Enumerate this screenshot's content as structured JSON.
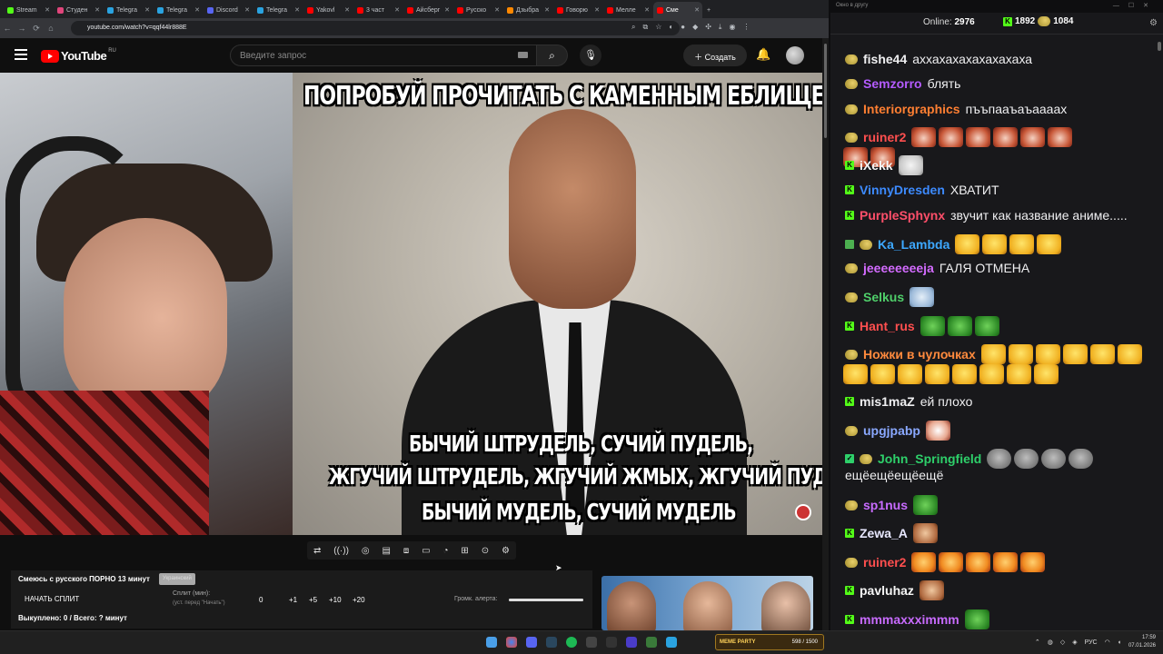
{
  "browser": {
    "tabs": [
      {
        "label": "Stream",
        "color": "#53fc18"
      },
      {
        "label": "Студен",
        "color": "#e0457b"
      },
      {
        "label": "Telegra",
        "color": "#2aa3e0"
      },
      {
        "label": "Telegra",
        "color": "#2aa3e0"
      },
      {
        "label": "Discord",
        "color": "#5865f2"
      },
      {
        "label": "Telegra",
        "color": "#2aa3e0"
      },
      {
        "label": "Yakovl",
        "color": "#ff0000"
      },
      {
        "label": "3 част",
        "color": "#ff0000"
      },
      {
        "label": "Айсберг",
        "color": "#ff0000"
      },
      {
        "label": "Русско",
        "color": "#ff0000"
      },
      {
        "label": "Дзыбра",
        "color": "#ff8800"
      },
      {
        "label": "Говорю",
        "color": "#ff0000"
      },
      {
        "label": "Мелле",
        "color": "#ff0000"
      },
      {
        "label": "Сме",
        "color": "#ff0000",
        "active": true
      }
    ],
    "new_tab": "+",
    "url": "youtube.com/watch?v=qqf44lr888E",
    "window_controls": [
      "⌄",
      "—",
      "☐",
      "✕"
    ]
  },
  "youtube": {
    "logo_text": "YouTube",
    "country": "RU",
    "search_placeholder": "Введите запрос",
    "create_label": "Создать"
  },
  "video": {
    "meme_top": "ПОПРОБУЙ ПРОЧИТАТЬ С КАМЕННЫМ ЕБЛИЩЕМ",
    "meme_line1": "БЫЧИЙ ШТРУДЕЛЬ, СУЧИЙ ПУДЕЛЬ,",
    "meme_line2": "ЖГУЧИЙ ШТРУДЕЛЬ, ЖГУЧИЙ ЖМЫХ, ЖГУЧИЙ ПУДЕЛЬ",
    "meme_line3": "БЫЧИЙ МУДЕЛЬ, СУЧИЙ МУДЕЛЬ"
  },
  "panel": {
    "title": "Смеюсь с русского ПОРНО 13 минут",
    "tag": "Украинский",
    "start_button": "НАЧАТЬ СПЛИТ",
    "split_label": "Сплит (мин):",
    "split_sub": "(уст. перед \"Начать\")",
    "split_value": "0",
    "increments": [
      "+1",
      "+5",
      "+10",
      "+20"
    ],
    "alert_label": "Громк. алерта:",
    "alert_volume": 1.0,
    "bought": "Выкуплено: 0 / Всего: ? минут"
  },
  "chat": {
    "window_title": "Окно в другу",
    "online_label": "Online:",
    "online_count": "2976",
    "kick_count": "1892",
    "twitch_count": "1084",
    "messages": [
      {
        "platform": "twitch",
        "user": "fishe44",
        "color": "#efeff1",
        "text": "аххахахахахахахаха",
        "emotes": []
      },
      {
        "platform": "twitch",
        "user": "Semzorro",
        "color": "#b45bff",
        "text": "блять",
        "emotes": []
      },
      {
        "platform": "twitch",
        "user": "Interiorgraphics",
        "color": "#ff7f32",
        "text": "пъъпааъаъааааx",
        "emotes": []
      },
      {
        "platform": "twitch",
        "user": "ruiner2",
        "color": "#ff4f4f",
        "text": "",
        "emotes": [
          "red",
          "red",
          "red",
          "red",
          "red",
          "red",
          "red",
          "red"
        ]
      },
      {
        "platform": "kick",
        "user": "iXekk",
        "color": "#f5f5f5",
        "text": "",
        "emotes": [
          "cat"
        ]
      },
      {
        "platform": "kick",
        "user": "VinnyDresden",
        "color": "#3d8bff",
        "text": "ХВАТИТ",
        "emotes": []
      },
      {
        "platform": "kick",
        "user": "PurpleSphynx",
        "color": "#ff4f6a",
        "text": "звучит как название аниме.....",
        "emotes": []
      },
      {
        "platform": "twitch-sub",
        "user": "Ka_Lambda",
        "color": "#3da8ff",
        "text": "",
        "emotes": [
          "laugh",
          "laugh",
          "laugh",
          "laugh"
        ]
      },
      {
        "platform": "twitch",
        "user": "jeeeeeeeeja",
        "color": "#d36bff",
        "text": "ГАЛЯ ОТМЕНА",
        "emotes": []
      },
      {
        "platform": "twitch",
        "user": "Selkus",
        "color": "#4fcf6a",
        "text": "",
        "emotes": [
          "blue"
        ]
      },
      {
        "platform": "kick",
        "user": "Hant_rus",
        "color": "#ff4f4f",
        "text": "",
        "emotes": [
          "pepe",
          "pepe",
          "pepe"
        ]
      },
      {
        "platform": "twitch",
        "user": "Ножки в чулочках",
        "color": "#ff8a3d",
        "text": "",
        "emotes": [
          "laugh",
          "laugh",
          "laugh",
          "laugh",
          "laugh",
          "laugh",
          "laugh",
          "laugh",
          "laugh",
          "laugh",
          "laugh",
          "laugh",
          "laugh",
          "laugh"
        ]
      },
      {
        "platform": "kick",
        "user": "mis1maZ",
        "color": "#efeff1",
        "text": "ей плохо",
        "emotes": []
      },
      {
        "platform": "twitch",
        "user": "upgjpabp",
        "color": "#8aa8ff",
        "text": "",
        "emotes": [
          "fist"
        ]
      },
      {
        "platform": "twitch-edit",
        "user": "John_Springfield",
        "color": "#2ecf6a",
        "text": "ещёещёещёещё",
        "emotes": [
          "gray",
          "gray",
          "gray",
          "gray"
        ]
      },
      {
        "platform": "twitch",
        "user": "sp1nus",
        "color": "#c86bff",
        "text": "",
        "emotes": [
          "pepe"
        ]
      },
      {
        "platform": "kick",
        "user": "Zewa_A",
        "color": "#e8e8ff",
        "text": "",
        "emotes": [
          "doge"
        ]
      },
      {
        "platform": "twitch",
        "user": "ruiner2",
        "color": "#ff4f4f",
        "text": "",
        "emotes": [
          "tiger",
          "tiger",
          "tiger",
          "tiger",
          "tiger"
        ]
      },
      {
        "platform": "kick",
        "user": "pavluhaz",
        "color": "#f5f5f5",
        "text": "",
        "emotes": [
          "doge"
        ]
      },
      {
        "platform": "kick",
        "user": "mmmaxxximmm",
        "color": "#c86bff",
        "text": "",
        "emotes": [
          "pepe"
        ]
      }
    ]
  },
  "taskbar": {
    "meme_party": "MEME PARTY",
    "meme_party_progress": "598 / 1500",
    "lang": "РУС",
    "time": "17:59",
    "date": "07.01.2026"
  }
}
